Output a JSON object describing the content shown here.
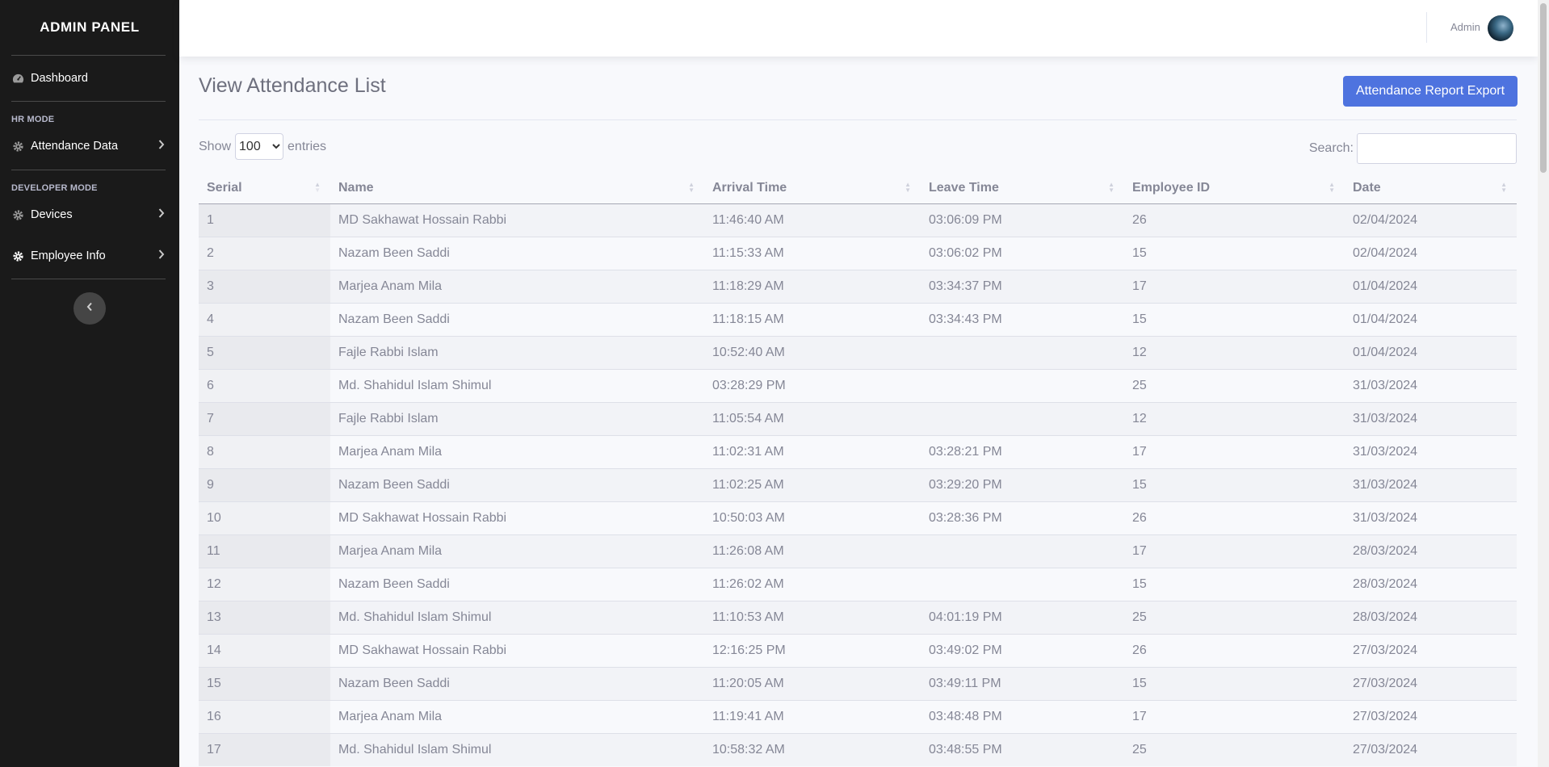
{
  "sidebar": {
    "brand": "ADMIN PANEL",
    "dashboard": "Dashboard",
    "hr_heading": "HR MODE",
    "attendance": "Attendance Data",
    "dev_heading": "DEVELOPER MODE",
    "devices": "Devices",
    "employee": "Employee Info"
  },
  "topbar": {
    "user": "Admin"
  },
  "page": {
    "title": "View Attendance List",
    "export_label": "Attendance Report Export",
    "show_label": "Show",
    "entries_label": "entries",
    "entries_value": "100",
    "search_label": "Search:"
  },
  "table": {
    "headers": [
      "Serial",
      "Name",
      "Arrival Time",
      "Leave Time",
      "Employee ID",
      "Date"
    ],
    "rows": [
      [
        "1",
        "MD Sakhawat Hossain Rabbi",
        "11:46:40 AM",
        "03:06:09 PM",
        "26",
        "02/04/2024"
      ],
      [
        "2",
        "Nazam Been Saddi",
        "11:15:33 AM",
        "03:06:02 PM",
        "15",
        "02/04/2024"
      ],
      [
        "3",
        "Marjea Anam Mila",
        "11:18:29 AM",
        "03:34:37 PM",
        "17",
        "01/04/2024"
      ],
      [
        "4",
        "Nazam Been Saddi",
        "11:18:15 AM",
        "03:34:43 PM",
        "15",
        "01/04/2024"
      ],
      [
        "5",
        "Fajle Rabbi Islam",
        "10:52:40 AM",
        "",
        "12",
        "01/04/2024"
      ],
      [
        "6",
        "Md. Shahidul Islam Shimul",
        "03:28:29 PM",
        "",
        "25",
        "31/03/2024"
      ],
      [
        "7",
        "Fajle Rabbi Islam",
        "11:05:54 AM",
        "",
        "12",
        "31/03/2024"
      ],
      [
        "8",
        "Marjea Anam Mila",
        "11:02:31 AM",
        "03:28:21 PM",
        "17",
        "31/03/2024"
      ],
      [
        "9",
        "Nazam Been Saddi",
        "11:02:25 AM",
        "03:29:20 PM",
        "15",
        "31/03/2024"
      ],
      [
        "10",
        "MD Sakhawat Hossain Rabbi",
        "10:50:03 AM",
        "03:28:36 PM",
        "26",
        "31/03/2024"
      ],
      [
        "11",
        "Marjea Anam Mila",
        "11:26:08 AM",
        "",
        "17",
        "28/03/2024"
      ],
      [
        "12",
        "Nazam Been Saddi",
        "11:26:02 AM",
        "",
        "15",
        "28/03/2024"
      ],
      [
        "13",
        "Md. Shahidul Islam Shimul",
        "11:10:53 AM",
        "04:01:19 PM",
        "25",
        "28/03/2024"
      ],
      [
        "14",
        "MD Sakhawat Hossain Rabbi",
        "12:16:25 PM",
        "03:49:02 PM",
        "26",
        "27/03/2024"
      ],
      [
        "15",
        "Nazam Been Saddi",
        "11:20:05 AM",
        "03:49:11 PM",
        "15",
        "27/03/2024"
      ],
      [
        "16",
        "Marjea Anam Mila",
        "11:19:41 AM",
        "03:48:48 PM",
        "17",
        "27/03/2024"
      ],
      [
        "17",
        "Md. Shahidul Islam Shimul",
        "10:58:32 AM",
        "03:48:55 PM",
        "25",
        "27/03/2024"
      ]
    ]
  },
  "icons": {
    "dashboard": "tachometer-icon",
    "gear": "gear-icon",
    "chevron": "chevron-right-icon",
    "toggle": "chevron-left-icon"
  },
  "colors": {
    "sidebar_bg": "#1a1a1a",
    "primary": "#4e73df",
    "text": "#858796"
  }
}
